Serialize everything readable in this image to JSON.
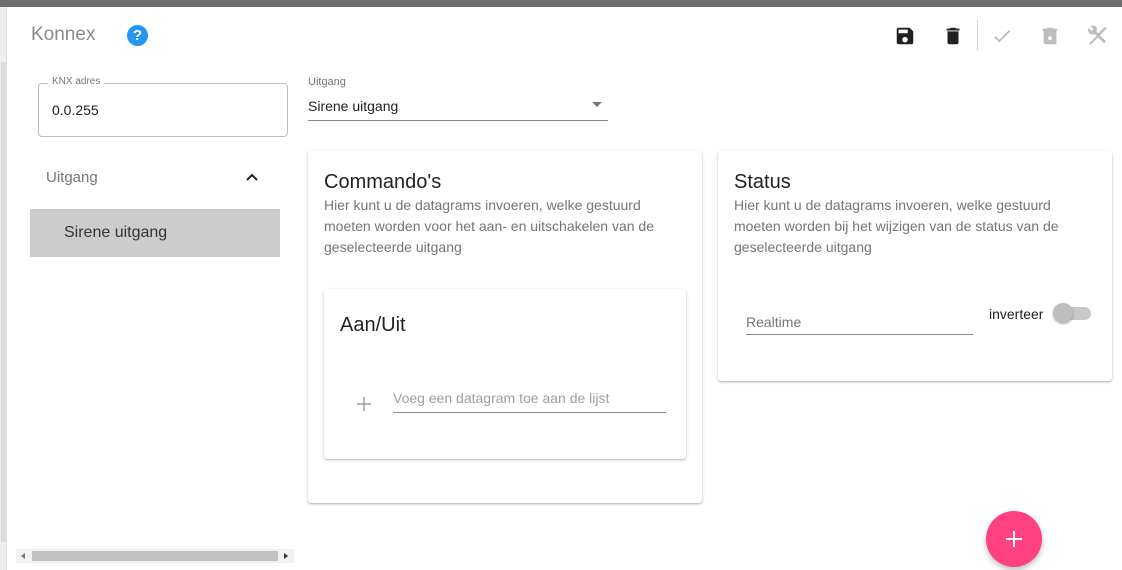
{
  "app": {
    "title": "Konnex",
    "help_icon": "help-circle-icon",
    "help_glyph": "?"
  },
  "toolbar": {
    "buttons": [
      {
        "name": "save-button",
        "icon": "floppy-disk-icon",
        "enabled": true
      },
      {
        "name": "delete-button",
        "icon": "trash-icon",
        "enabled": true
      },
      {
        "name": "confirm-button",
        "icon": "check-icon",
        "enabled": false
      },
      {
        "name": "discard-button",
        "icon": "trash-x-icon",
        "enabled": false
      },
      {
        "name": "tools-button",
        "icon": "tools-off-icon",
        "enabled": false
      }
    ]
  },
  "knx_address": {
    "label": "KNX adres",
    "value": "0.0.255"
  },
  "output_select": {
    "label": "Uitgang",
    "value": "Sirene uitgang"
  },
  "tree": {
    "header": "Uitgang",
    "items": [
      {
        "label": "Sirene uitgang",
        "selected": true
      }
    ]
  },
  "commands_card": {
    "title": "Commando's",
    "description": "Hier kunt u de datagrams invoeren, welke gestuurd moeten worden voor het aan- en uitschakelen van de geselecteerde uitgang",
    "subcard": {
      "title": "Aan/Uit",
      "add_placeholder": "Voeg een datagram toe aan de lijst"
    }
  },
  "status_card": {
    "title": "Status",
    "description": "Hier kunt u de datagrams invoeren, welke gestuurd moeten worden bij het wijzigen van de status van de geselecteerde uitgang",
    "realtime_placeholder": "Realtime",
    "invert_label": "inverteer",
    "invert_on": false
  },
  "colors": {
    "accent": "#ff4081",
    "help": "#2196f3",
    "selected_item": "#cccccc"
  }
}
